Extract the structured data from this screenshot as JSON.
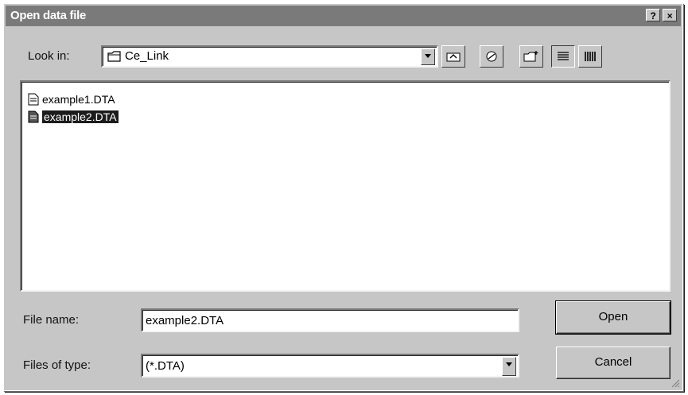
{
  "window": {
    "title": "Open data file",
    "help_button": "?",
    "close_button": "×"
  },
  "look_in": {
    "label": "Look in:",
    "value": "Ce_Link"
  },
  "toolbar": {
    "icons": [
      "up-one-level-icon",
      "desktop-icon",
      "new-folder-icon",
      "list-view-icon",
      "details-view-icon"
    ]
  },
  "files": [
    {
      "name": "example1.DTA",
      "selected": false
    },
    {
      "name": "example2.DTA",
      "selected": true
    }
  ],
  "file_name": {
    "label": "File name:",
    "value": "example2.DTA"
  },
  "file_type": {
    "label": "Files of type:",
    "value": "(*.DTA)"
  },
  "buttons": {
    "open": "Open",
    "cancel": "Cancel"
  },
  "colors": {
    "face": "#c6c6c6",
    "title_bar": "#7a7a7a",
    "selection": "#1c1c1c"
  }
}
